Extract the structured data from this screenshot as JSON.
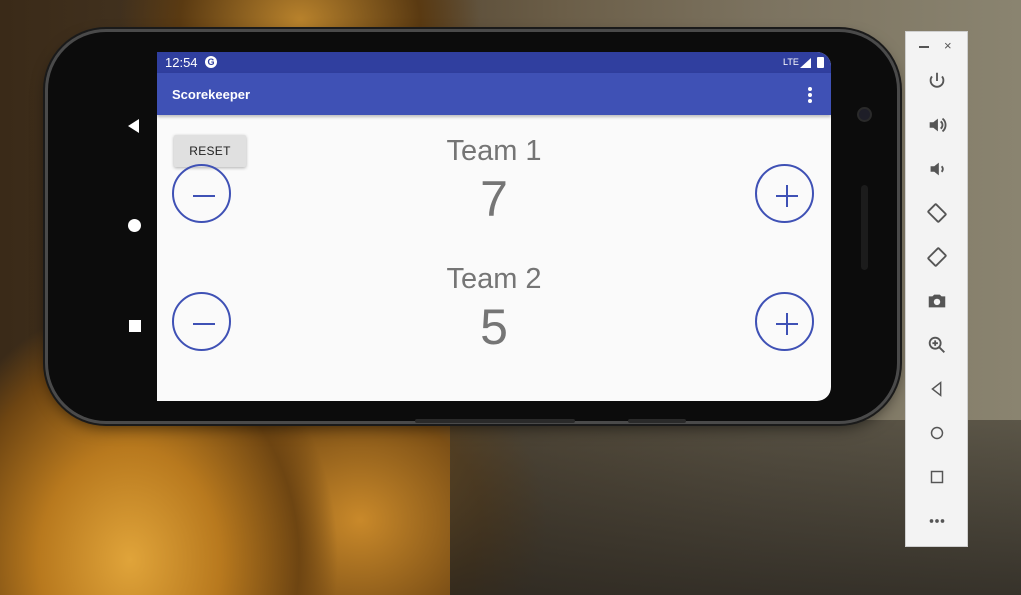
{
  "status_bar": {
    "time": "12:54",
    "notification_glyph": "G",
    "network": "LTE"
  },
  "app_bar": {
    "title": "Scorekeeper"
  },
  "reset_button": {
    "label": "RESET"
  },
  "teams": [
    {
      "name": "Team 1",
      "score": "7"
    },
    {
      "name": "Team 2",
      "score": "5"
    }
  ],
  "emulator_toolbar": {
    "close_glyph": "×",
    "tools": [
      "power-icon",
      "volume-up-icon",
      "volume-down-icon",
      "rotate-left-icon",
      "rotate-right-icon",
      "camera-icon",
      "zoom-icon",
      "back-icon",
      "home-icon",
      "overview-icon",
      "more-icon"
    ]
  },
  "colors": {
    "primary": "#3f51b5",
    "primary_dark": "#303f9f",
    "score_text": "#757575"
  }
}
